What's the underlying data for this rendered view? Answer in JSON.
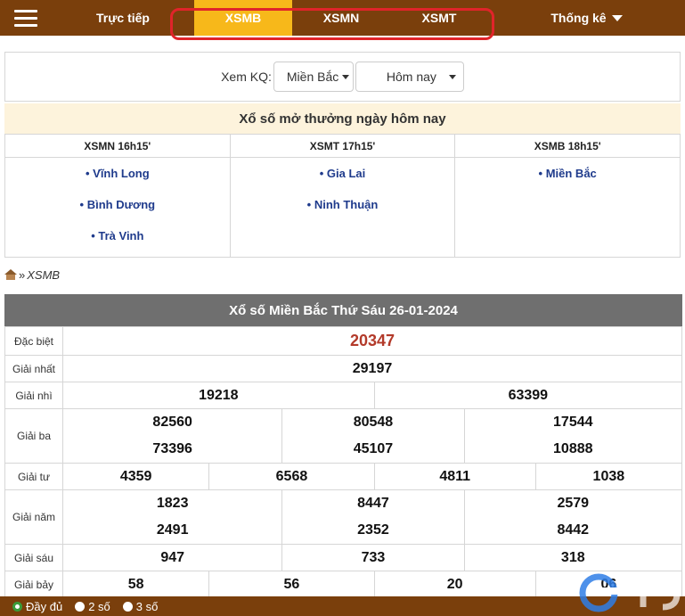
{
  "nav": {
    "live": "Trực tiếp",
    "xsmb": "XSMB",
    "xsmn": "XSMN",
    "xsmt": "XSMT",
    "stats": "Thống kê"
  },
  "filter": {
    "label": "Xem KQ:",
    "region": "Miền Bắc",
    "day": "Hôm nay"
  },
  "today": {
    "title": "Xổ số mở thưởng ngày hôm nay",
    "columns": [
      {
        "header": "XSMN 16h15'",
        "items": [
          "• Vĩnh Long",
          "• Bình Dương",
          "• Trà Vinh"
        ]
      },
      {
        "header": "XSMT 17h15'",
        "items": [
          "• Gia Lai",
          "• Ninh Thuận"
        ]
      },
      {
        "header": "XSMB 18h15'",
        "items": [
          "• Miền Bắc"
        ]
      }
    ]
  },
  "breadcrumb": {
    "sep": "»",
    "current": "XSMB"
  },
  "results": {
    "title": "Xổ số Miền Bắc Thứ Sáu 26-01-2024",
    "prizes": {
      "special": {
        "label": "Đặc biệt",
        "numbers": [
          "20347"
        ]
      },
      "first": {
        "label": "Giải nhất",
        "numbers": [
          "29197"
        ]
      },
      "second": {
        "label": "Giải nhì",
        "numbers": [
          "19218",
          "63399"
        ]
      },
      "third": {
        "label": "Giải ba",
        "numbers": [
          "82560",
          "73396",
          "80548",
          "45107",
          "17544",
          "10888"
        ]
      },
      "fourth": {
        "label": "Giải tư",
        "numbers": [
          "4359",
          "6568",
          "4811",
          "1038"
        ]
      },
      "fifth": {
        "label": "Giải năm",
        "numbers": [
          "1823",
          "2491",
          "8447",
          "2352",
          "2579",
          "8442"
        ]
      },
      "sixth": {
        "label": "Giải sáu",
        "numbers": [
          "947",
          "733",
          "318"
        ]
      },
      "seventh": {
        "label": "Giải bảy",
        "numbers": [
          "58",
          "56",
          "20",
          "06"
        ]
      }
    }
  },
  "options": {
    "full": "Đầy đủ",
    "two": "2 số",
    "three": "3 số"
  },
  "colors": {
    "brand": "#7a3f0c",
    "active_tab": "#f7b81a",
    "highlight_ring": "#e0242a",
    "special_number": "#b33a2a"
  }
}
